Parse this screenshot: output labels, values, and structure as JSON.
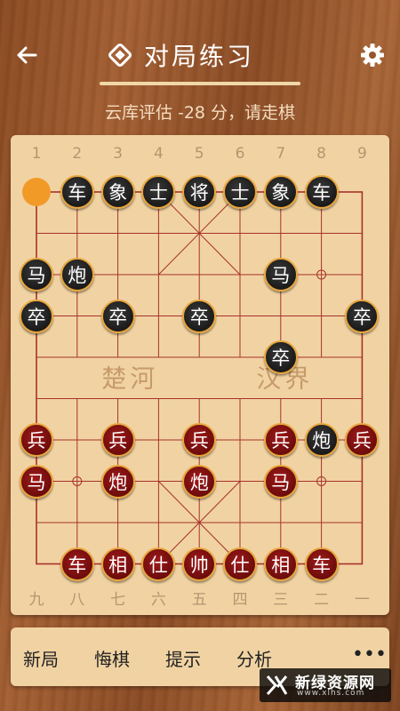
{
  "header": {
    "title": "对局练习",
    "status": "云库评估 -28 分，请走棋"
  },
  "board": {
    "top_labels": [
      "1",
      "2",
      "3",
      "4",
      "5",
      "6",
      "7",
      "8",
      "9"
    ],
    "bottom_labels": [
      "九",
      "八",
      "七",
      "六",
      "五",
      "四",
      "三",
      "二",
      "一"
    ],
    "river_left": "楚河",
    "river_right": "汉界",
    "selected": {
      "col": 0,
      "row": 0
    },
    "pieces": [
      {
        "label": "车",
        "side": "black",
        "col": 1,
        "row": 0
      },
      {
        "label": "象",
        "side": "black",
        "col": 2,
        "row": 0
      },
      {
        "label": "士",
        "side": "black",
        "col": 3,
        "row": 0
      },
      {
        "label": "将",
        "side": "black",
        "col": 4,
        "row": 0
      },
      {
        "label": "士",
        "side": "black",
        "col": 5,
        "row": 0
      },
      {
        "label": "象",
        "side": "black",
        "col": 6,
        "row": 0
      },
      {
        "label": "车",
        "side": "black",
        "col": 7,
        "row": 0
      },
      {
        "label": "马",
        "side": "black",
        "col": 0,
        "row": 2
      },
      {
        "label": "炮",
        "side": "black",
        "col": 1,
        "row": 2
      },
      {
        "label": "马",
        "side": "black",
        "col": 6,
        "row": 2
      },
      {
        "label": "卒",
        "side": "black",
        "col": 0,
        "row": 3
      },
      {
        "label": "卒",
        "side": "black",
        "col": 2,
        "row": 3
      },
      {
        "label": "卒",
        "side": "black",
        "col": 4,
        "row": 3
      },
      {
        "label": "卒",
        "side": "black",
        "col": 8,
        "row": 3
      },
      {
        "label": "卒",
        "side": "black",
        "col": 6,
        "row": 4
      },
      {
        "label": "炮",
        "side": "black",
        "col": 7,
        "row": 6
      },
      {
        "label": "兵",
        "side": "red",
        "col": 0,
        "row": 6
      },
      {
        "label": "兵",
        "side": "red",
        "col": 2,
        "row": 6
      },
      {
        "label": "兵",
        "side": "red",
        "col": 4,
        "row": 6
      },
      {
        "label": "兵",
        "side": "red",
        "col": 6,
        "row": 6
      },
      {
        "label": "兵",
        "side": "red",
        "col": 8,
        "row": 6
      },
      {
        "label": "马",
        "side": "red",
        "col": 0,
        "row": 7
      },
      {
        "label": "炮",
        "side": "red",
        "col": 2,
        "row": 7
      },
      {
        "label": "炮",
        "side": "red",
        "col": 4,
        "row": 7
      },
      {
        "label": "马",
        "side": "red",
        "col": 6,
        "row": 7
      },
      {
        "label": "车",
        "side": "red",
        "col": 1,
        "row": 9
      },
      {
        "label": "相",
        "side": "red",
        "col": 2,
        "row": 9
      },
      {
        "label": "仕",
        "side": "red",
        "col": 3,
        "row": 9
      },
      {
        "label": "帅",
        "side": "red",
        "col": 4,
        "row": 9
      },
      {
        "label": "仕",
        "side": "red",
        "col": 5,
        "row": 9
      },
      {
        "label": "相",
        "side": "red",
        "col": 6,
        "row": 9
      },
      {
        "label": "车",
        "side": "red",
        "col": 7,
        "row": 9
      }
    ]
  },
  "toolbar": {
    "new_game": "新局",
    "undo": "悔棋",
    "hint": "提示",
    "analyze": "分析",
    "more": "•••"
  },
  "watermark": {
    "title": "新绿资源网",
    "url": "www.xlhs.com"
  },
  "colors": {
    "board": "#f1d3a3",
    "line": "#a8322a",
    "black_piece": "#1a1a1a",
    "red_piece": "#7a0f0f",
    "piece_ring": "#e8a63c",
    "selection": "#f29a28"
  }
}
